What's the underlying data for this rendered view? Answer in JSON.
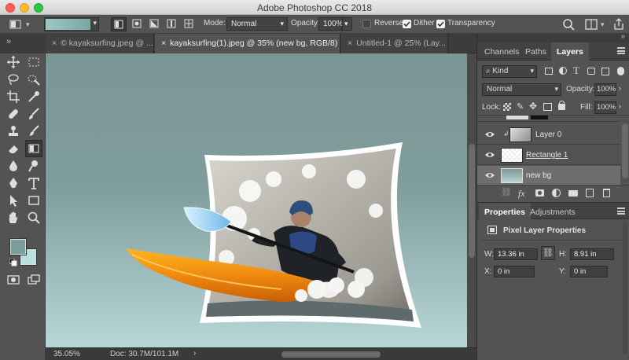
{
  "app": {
    "title": "Adobe Photoshop CC 2018"
  },
  "options_bar": {
    "mode_label": "Mode:",
    "mode_value": "Normal",
    "opacity_label": "Opacity:",
    "opacity_value": "100%",
    "reverse_label": "Reverse",
    "reverse_checked": false,
    "dither_label": "Dither",
    "dither_checked": true,
    "transparency_label": "Transparency",
    "transparency_checked": true,
    "gradient_color": "#9cc8c8"
  },
  "tabs": [
    {
      "label": "© kayaksurfing.jpeg @ ..."
    },
    {
      "label": "kayaksurfing(1).jpeg @ 35% (new bg, RGB/8) *"
    },
    {
      "label": "Untitled-1 @ 25% (Lay..."
    }
  ],
  "tab_close_glyph": "×",
  "toolbar": {
    "expand_glyph": "»",
    "more_glyph": "…",
    "foreground_color": "#7a9e9e",
    "background_color": "#b8e0e0"
  },
  "status": {
    "zoom": "35.05%",
    "doc": "Doc: 30.7M/101.1M",
    "arrow": "›"
  },
  "layers_panel": {
    "tabs": [
      "Channels",
      "Paths",
      "Layers"
    ],
    "filter_label": "Kind",
    "blend_mode": "Normal",
    "opacity_label": "Opacity:",
    "opacity_value": "100%",
    "lock_label": "Lock:",
    "fill_label": "Fill:",
    "fill_value": "100%",
    "layers": [
      {
        "name": "Layer 0"
      },
      {
        "name": "Rectangle 1"
      },
      {
        "name": "new bg"
      }
    ],
    "footer_fx": "fx"
  },
  "properties_panel": {
    "tabs": [
      "Properties",
      "Adjustments"
    ],
    "heading": "Pixel Layer Properties",
    "w_label": "W:",
    "w_value": "13.36 in",
    "h_label": "H:",
    "h_value": "8.91 in",
    "x_label": "X:",
    "x_value": "0 in",
    "y_label": "Y:",
    "y_value": "0 in"
  }
}
